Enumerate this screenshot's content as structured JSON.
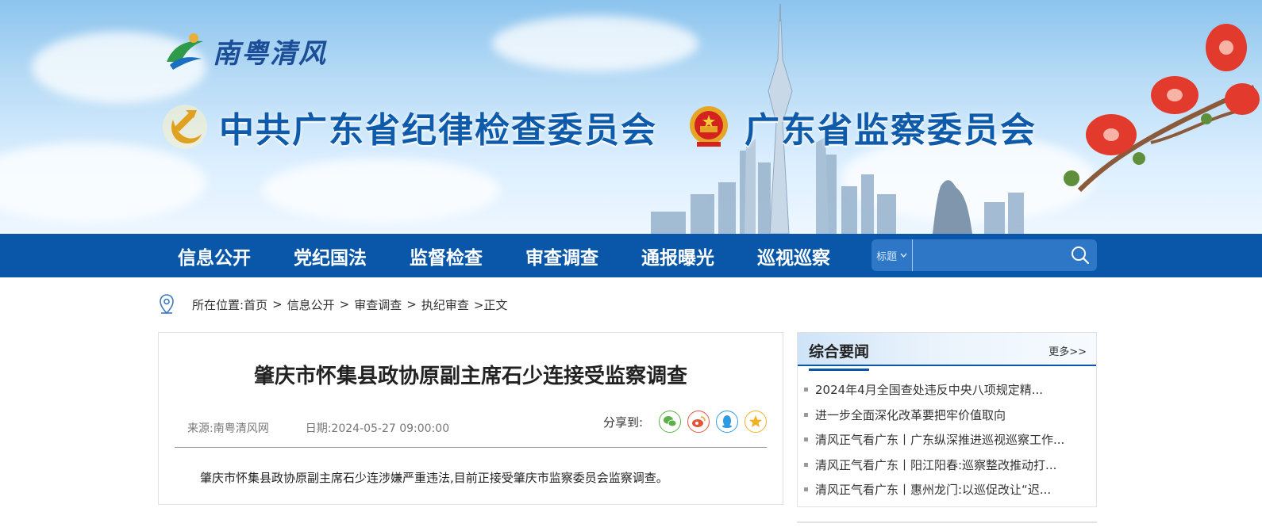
{
  "banner": {
    "logo_text": "南粤清风",
    "org_left": "中共广东省纪律检查委员会",
    "org_right": "广东省监察委员会"
  },
  "nav": {
    "items": [
      {
        "label": "信息公开"
      },
      {
        "label": "党纪国法"
      },
      {
        "label": "监督检查"
      },
      {
        "label": "审查调查"
      },
      {
        "label": "通报曝光"
      },
      {
        "label": "巡视巡察"
      }
    ],
    "search": {
      "select_value": "标题",
      "input_value": "",
      "button_icon": "search-icon"
    }
  },
  "breadcrumb": {
    "label": "所在位置:",
    "items": [
      "首页",
      "信息公开",
      "审查调查",
      "执纪审查"
    ],
    "sep": ">",
    "current": ">正文"
  },
  "article": {
    "title": "肇庆市怀集县政协原副主席石少连接受监察调查",
    "source": "来源:南粤清风网",
    "date": "日期:2024-05-27 09:00:00",
    "share_label": "分享到:",
    "share_icons": [
      "wechat-icon",
      "weibo-icon",
      "qq-icon",
      "qzone-icon"
    ],
    "body": "肇庆市怀集县政协原副主席石少连涉嫌严重违法,目前正接受肇庆市监察委员会监察调查。"
  },
  "sidebar": {
    "title": "综合要闻",
    "more": "更多>>",
    "items": [
      {
        "text": "2024年4月全国查处违反中央八项规定精..."
      },
      {
        "text": "进一步全面深化改革要把牢价值取向"
      },
      {
        "text": "清风正气看广东丨广东纵深推进巡视巡察工作..."
      },
      {
        "text": "清风正气看广东丨阳江阳春:巡察整改推动打..."
      },
      {
        "text": "清风正气看广东丨惠州龙门:以巡促改让“迟..."
      }
    ]
  },
  "colors": {
    "nav_blue": "#0a57a9",
    "title_blue": "#0e5aab",
    "search_bg": "#2e76c6"
  }
}
